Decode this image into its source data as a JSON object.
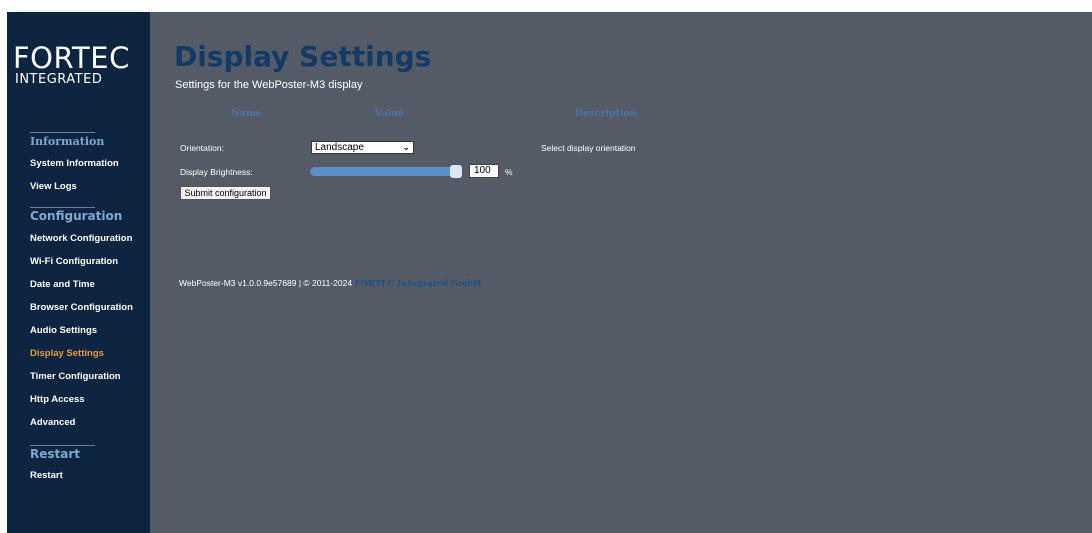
{
  "logo": {
    "main": "FORTEC",
    "sub": "INTEGRATED"
  },
  "sidebar": {
    "sections": [
      {
        "title": "Information",
        "items": [
          "System Information",
          "View Logs"
        ]
      },
      {
        "title": "Configuration",
        "items": [
          "Network Configuration",
          "Wi-Fi Configuration",
          "Date and Time",
          "Browser Configuration",
          "Audio Settings",
          "Display Settings",
          "Timer Configuration",
          "Http Access",
          "Advanced"
        ]
      },
      {
        "title": "Restart",
        "items": [
          "Restart"
        ]
      }
    ],
    "active_item": "Display Settings"
  },
  "page": {
    "title": "Display Settings",
    "subtitle": "Settings for the WebPoster-M3 display"
  },
  "table": {
    "headers": {
      "name": "Name",
      "value": "Value",
      "description": "Description"
    }
  },
  "orientation": {
    "label": "Orientation:",
    "value": "Landscape",
    "description": "Select display orientation"
  },
  "brightness": {
    "label": "Display Brightness:",
    "value": "100",
    "level_fraction": 1.0,
    "unit": "%"
  },
  "submit_label": "Submit configuration",
  "footer": {
    "text": "WebPoster-M3 v1.0.0.9e57689 | © 2011-2024 ",
    "link": "FORTEC Integrated GmbH"
  },
  "colors": {
    "sidebar_bg": "#0d2540",
    "content_bg": "#545b66",
    "accent_active": "#e69a3b",
    "section_title": "#7fa8d3",
    "heading": "#123a66"
  }
}
